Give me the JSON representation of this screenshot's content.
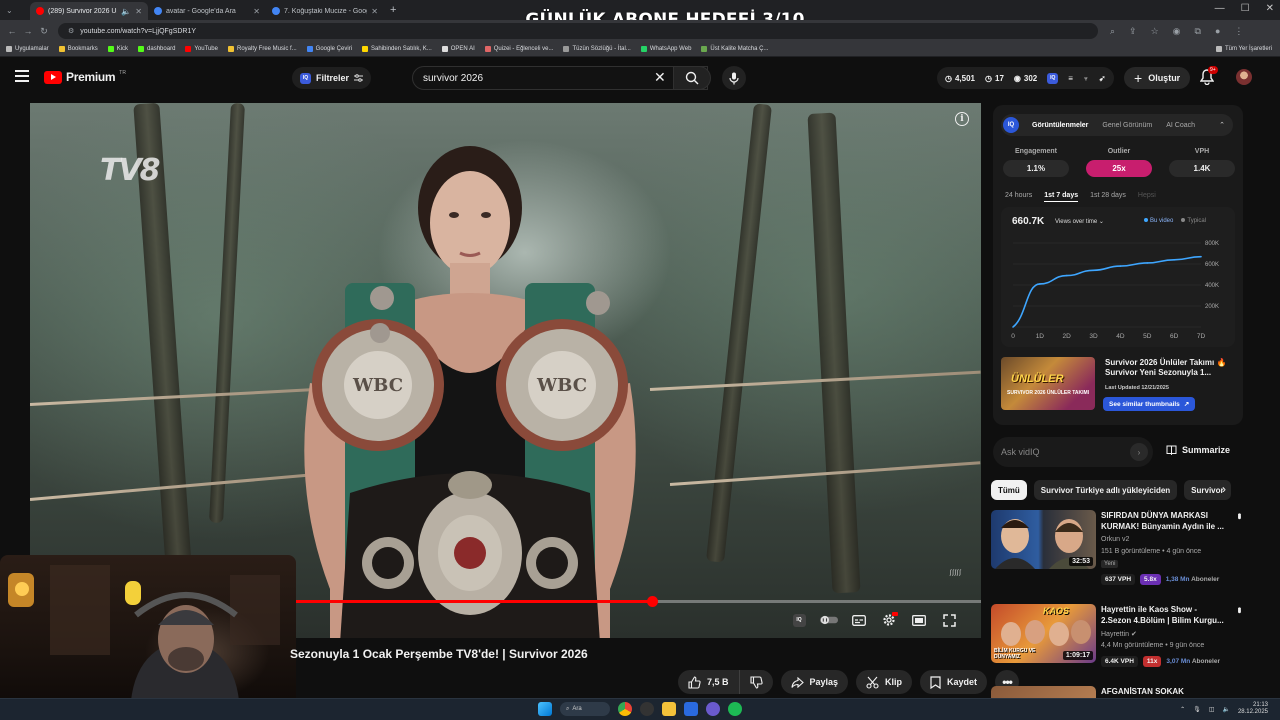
{
  "overlay_title": "GÜNLÜK ABONE HEDEFİ 3/10",
  "browser": {
    "tabs": [
      {
        "title": "(289) Survivor 2026 Ünlüler",
        "active": true,
        "favicon_color": "#ff0000"
      },
      {
        "title": "avatar - Google'da Ara",
        "active": false,
        "favicon_color": "#4285f4"
      },
      {
        "title": "7. Koğuştaki Mucize - Google'da",
        "active": false,
        "favicon_color": "#4285f4"
      }
    ],
    "new_tab": "+",
    "url": "youtube.com/watch?v=LjjQFgSDR1Y",
    "bookmarks": [
      "Uygulamalar",
      "Bookmarks",
      "Kick",
      "dashboard",
      "YouTube",
      "Royalty Free Music f...",
      "Google Çeviri",
      "Sahibinden Satılık, K...",
      "OPEN AI",
      "Quizei - Eğlenceli ve...",
      "Tüzün Sözlüğü - İtal...",
      "WhatsApp Web",
      "Üst Kalite Matcha Ç..."
    ],
    "bookmarks_right": "Tüm Yer İşaretleri"
  },
  "header": {
    "logo": "Premium",
    "logo_sup": "TR",
    "filters_label": "Filtreler",
    "iq_label": "IQ",
    "search_value": "survivor 2026",
    "stats": [
      "4,501",
      "17",
      "302"
    ],
    "create_label": "Oluştur",
    "bell_badge": "9+"
  },
  "video": {
    "channel_watermark": "TV8",
    "progress": 0.52,
    "title": "Sezonuyla 1 Ocak Perşembe TV8'de! | Survivor 2026",
    "watermark_br": "ʃʃʃʃʃ"
  },
  "actions": {
    "like": "7,5 B",
    "share": "Paylaş",
    "clip": "Klip",
    "save": "Kaydet"
  },
  "vidiq": {
    "logo": "IQ",
    "tabs": [
      "Görüntülenmeler",
      "Genel Görünüm",
      "AI Coach"
    ],
    "metrics": [
      {
        "label": "Engagement",
        "value": "1.1%"
      },
      {
        "label": "Outlier",
        "value": "25x"
      },
      {
        "label": "VPH",
        "value": "1.4K"
      }
    ],
    "periods": [
      "24 hours",
      "1st 7 days",
      "1st 28 days",
      "Hepsi"
    ],
    "chart_views": "660.7K",
    "chart_mode": "Views over time",
    "legend_this": "Bu video",
    "legend_typical": "Typical",
    "thumb_big": "ÜNLÜLER",
    "thumb_small": "SURVIVOR 2026 ÜNLÜLER TAKIMI",
    "thumb_title": "Survivor 2026 Ünlüler Takımı 🔥 Survivor Yeni Sezonuyla 1...",
    "thumb_updated": "Last Updated 12/21/2025",
    "thumb_button": "See similar thumbnails",
    "ask_placeholder": "Ask vidIQ",
    "summarize": "Summarize"
  },
  "chart_data": {
    "type": "line",
    "x": [
      "0",
      "1D",
      "2D",
      "3D",
      "4D",
      "5D",
      "6D",
      "7D"
    ],
    "y_ticks": [
      "0",
      "200K",
      "400K",
      "600K",
      "800K"
    ],
    "ylim": [
      0,
      800000
    ],
    "series": [
      {
        "name": "Bu video",
        "values": [
          0,
          410000,
          490000,
          540000,
          580000,
          610000,
          640000,
          670000
        ]
      }
    ],
    "color": "#3ea6ff"
  },
  "chips": [
    "Tümü",
    "Survivor Türkiye adlı yükleyiciden",
    "Survivor"
  ],
  "recommendations": [
    {
      "title": "SIFIRDAN DÜNYA MARKASI KURMAK! Bünyamin Aydın ile ...",
      "channel": "Orkun v2",
      "meta": "151 B görüntüleme • 4 gün önce",
      "badge": "Yeni",
      "duration": "32:53",
      "vph": "637 VPH",
      "mult": "5.8x",
      "subs": "1,38 Mn",
      "subs_label": "Aboneler"
    },
    {
      "title": "Hayrettin ile Kaos Show - 2.Sezon 4.Bölüm | Bilim Kurgu...",
      "channel": "Hayrettin",
      "meta": "4,4 Mn görüntüleme • 9 gün önce",
      "badge": "",
      "duration": "1:09:17",
      "vph": "6.4K VPH",
      "mult": "11x",
      "subs": "3,07 Mn",
      "subs_label": "Aboneler",
      "thumb_text1": "KAOS",
      "thumb_text2": "BİLİM KURGU VE DÜNYAMIZ"
    },
    {
      "title": "AFGANİSTAN SOKAK"
    }
  ],
  "taskbar": {
    "search": "Ara",
    "time": "21:13",
    "date": "28.12.2025"
  }
}
